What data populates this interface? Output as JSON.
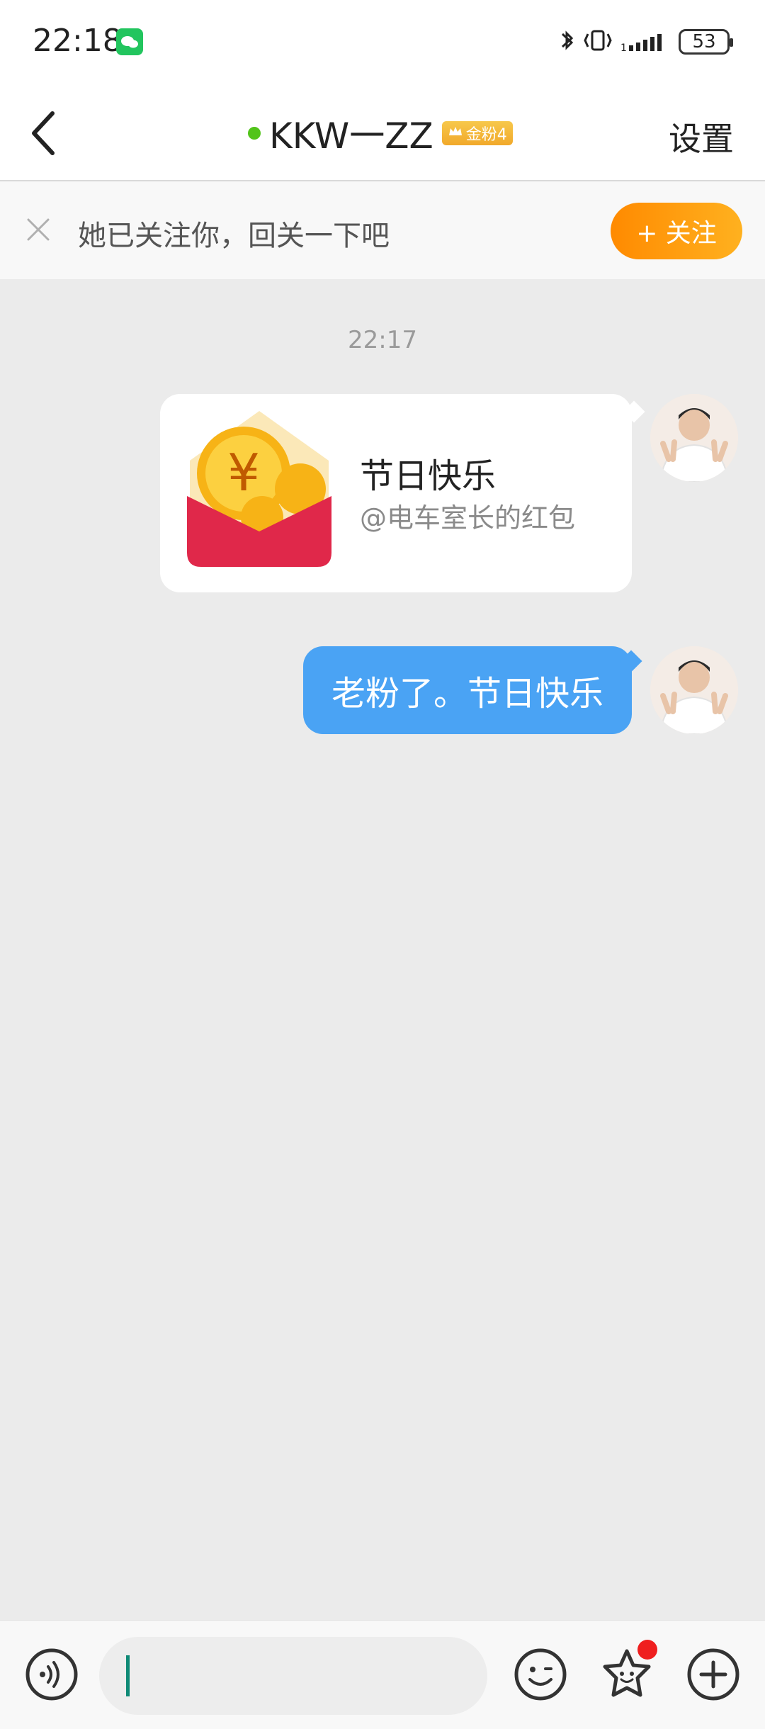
{
  "status_bar": {
    "time": "22:18",
    "battery": "53",
    "signal_small": "1"
  },
  "header": {
    "title": "KKW一ZZ",
    "badge": "金粉4",
    "settings": "设置"
  },
  "follow_bar": {
    "text": "她已关注你，回关一下吧",
    "button": "+ 关注"
  },
  "chat": {
    "timestamp": "22:17",
    "red_packet": {
      "title": "节日快乐",
      "subtitle": "@电车室长的红包"
    },
    "text_message": "老粉了。节日快乐"
  },
  "bottom_bar": {
    "input_value": ""
  },
  "colors": {
    "accent_orange": "#ff9a0a",
    "bubble_blue": "#4aa3f4",
    "online_green": "#52c41a"
  }
}
